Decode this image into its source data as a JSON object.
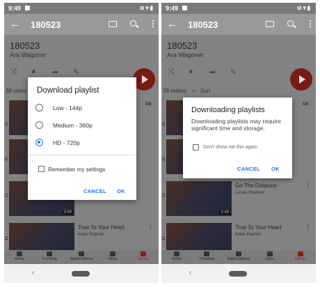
{
  "left_screen": {
    "status": {
      "time": "9:49"
    },
    "appbar": {
      "title": "180523"
    },
    "playlist": {
      "title": "180523",
      "author": "Ara Wagoner",
      "count_text": "38 video"
    },
    "videos": [
      {
        "title": "",
        "subtitle": "",
        "duration": ""
      },
      {
        "title": "",
        "subtitle": "",
        "duration": ""
      },
      {
        "title": "",
        "subtitle": "",
        "duration": "3:49"
      },
      {
        "title": "True To Your Heart",
        "subtitle": "Keke Palmer",
        "duration": ""
      }
    ],
    "partial_text": "tar",
    "nav": [
      "Home",
      "Trending",
      "Subscriptions",
      "Inbox",
      "Library"
    ],
    "dialog": {
      "title": "Download playlist",
      "options": [
        "Low - 144p",
        "Medium - 360p",
        "HD - 720p"
      ],
      "selected_index": 2,
      "remember_label": "Remember my settings",
      "remember_checked": false,
      "cancel_label": "CANCEL",
      "ok_label": "OK"
    }
  },
  "right_screen": {
    "status": {
      "time": "9:49"
    },
    "appbar": {
      "title": "180523"
    },
    "playlist": {
      "title": "180523",
      "author": "Ara Wagoner",
      "count_text": "38 videos",
      "sort_label": "Sort"
    },
    "videos": [
      {
        "title": "",
        "subtitle": "",
        "duration": ""
      },
      {
        "title": "",
        "subtitle": "",
        "duration": ""
      },
      {
        "title": "Go The Distance",
        "subtitle": "Lucas Grabeel",
        "duration": "3:49"
      },
      {
        "title": "True To Your Heart",
        "subtitle": "Keke Palmer",
        "duration": ""
      }
    ],
    "partial_text": "tar",
    "nav": [
      "Home",
      "Trending",
      "Subscriptions",
      "Inbox",
      "Library"
    ],
    "dialog": {
      "title": "Downloading playlists",
      "body": "Downloading playlists may require significant time and storage.",
      "dont_show_label": "Don't show me this again",
      "dont_show_checked": false,
      "cancel_label": "CANCEL",
      "ok_label": "OK"
    }
  },
  "colors": {
    "accent": "#1a73e8",
    "brand_red": "#8a1d15",
    "scrim": "#828282"
  },
  "icons": [
    "back-arrow-icon",
    "cast-icon",
    "search-icon",
    "more-vert-icon",
    "shuffle-icon",
    "account-icon",
    "share-icon",
    "edit-icon",
    "play-icon",
    "home-icon",
    "trending-icon",
    "subscriptions-icon",
    "inbox-icon",
    "library-icon",
    "drag-handle-icon"
  ]
}
